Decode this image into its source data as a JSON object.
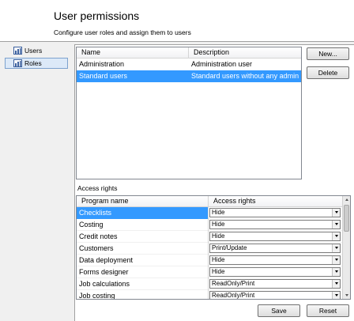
{
  "header": {
    "title": "User permissions",
    "subtitle": "Configure user roles and assign them to users"
  },
  "nav": {
    "items": [
      {
        "label": "Users",
        "icon": "users-icon",
        "selected": false
      },
      {
        "label": "Roles",
        "icon": "roles-icon",
        "selected": true
      }
    ]
  },
  "roles_grid": {
    "columns": [
      "Name",
      "Description"
    ],
    "rows": [
      {
        "name": "Administration",
        "description": "Administration user",
        "selected": false
      },
      {
        "name": "Standard users",
        "description": "Standard users without any admin",
        "selected": true
      }
    ]
  },
  "buttons": {
    "new_label": "New...",
    "delete_label": "Delete",
    "save_label": "Save",
    "reset_label": "Reset"
  },
  "access": {
    "section_label": "Access rights",
    "columns": [
      "Program name",
      "Access rights"
    ],
    "rows": [
      {
        "program": "Checklists",
        "right": "Hide",
        "selected": true
      },
      {
        "program": "Costing",
        "right": "Hide",
        "selected": false
      },
      {
        "program": "Credit notes",
        "right": "Hide",
        "selected": false
      },
      {
        "program": "Customers",
        "right": "Print/Update",
        "selected": false
      },
      {
        "program": "Data deployment",
        "right": "Hide",
        "selected": false
      },
      {
        "program": "Forms designer",
        "right": "Hide",
        "selected": false
      },
      {
        "program": "Job calculations",
        "right": "ReadOnly/Print",
        "selected": false
      },
      {
        "program": "Job costing",
        "right": "ReadOnly/Print",
        "selected": false
      }
    ]
  },
  "colors": {
    "selection": "#3399ff",
    "nav_selection": "#dce9f8",
    "header_bg": "#ffffff",
    "window_bg": "#f0f0f0"
  }
}
